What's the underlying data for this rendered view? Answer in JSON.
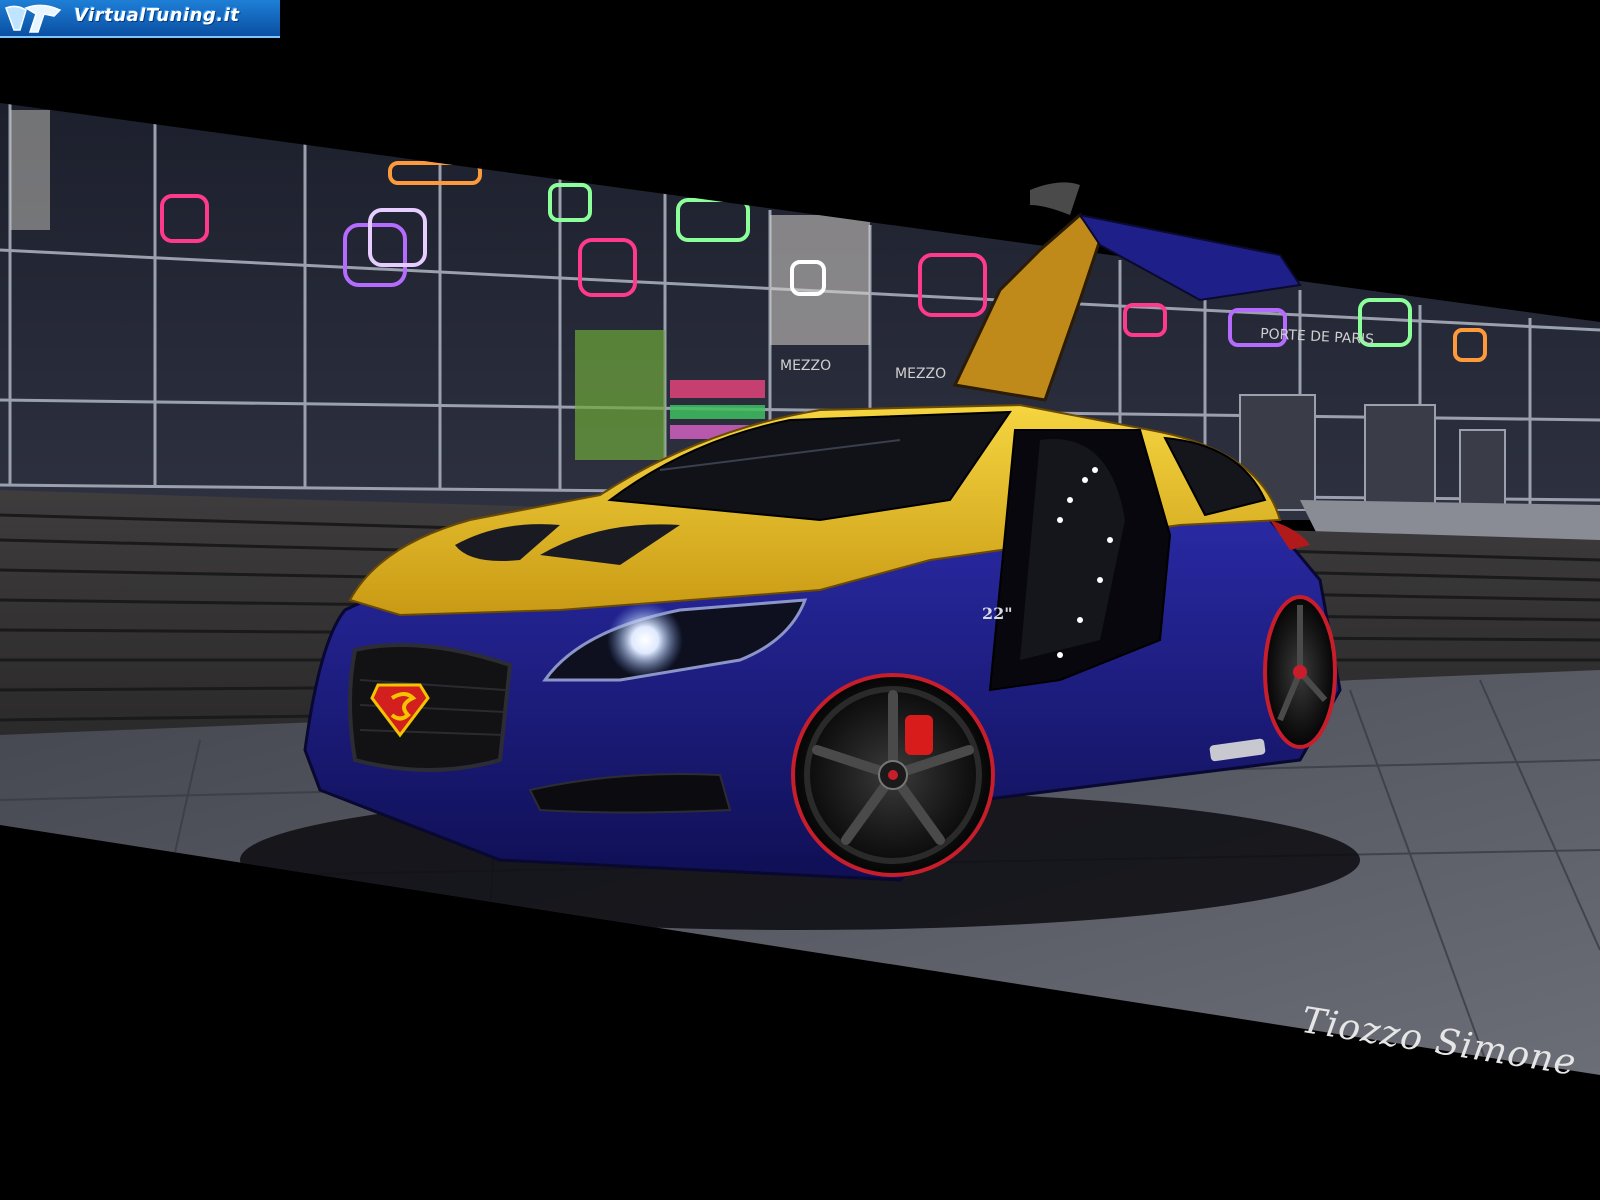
{
  "watermark": {
    "text": "VirtualTuning.it",
    "icon": "vt-logo-icon",
    "color_bg": "#1565c0",
    "color_text": "#ffffff"
  },
  "scene": {
    "wheel_size_label": "22\"",
    "store_sign_left": "MEZZO",
    "store_sign_right": "MEZZO",
    "building_sign": "PORTE DE PARIS"
  },
  "signature": {
    "text": "Tiozzo Simone"
  },
  "colors": {
    "car_body_blue": "#1f1f8a",
    "car_roof_yellow": "#e6b820",
    "background": "#000000",
    "ground": "#5a5c66",
    "neon_pink": "#ff3a8c",
    "neon_violet": "#b66bff",
    "neon_green": "#8cff9a"
  }
}
